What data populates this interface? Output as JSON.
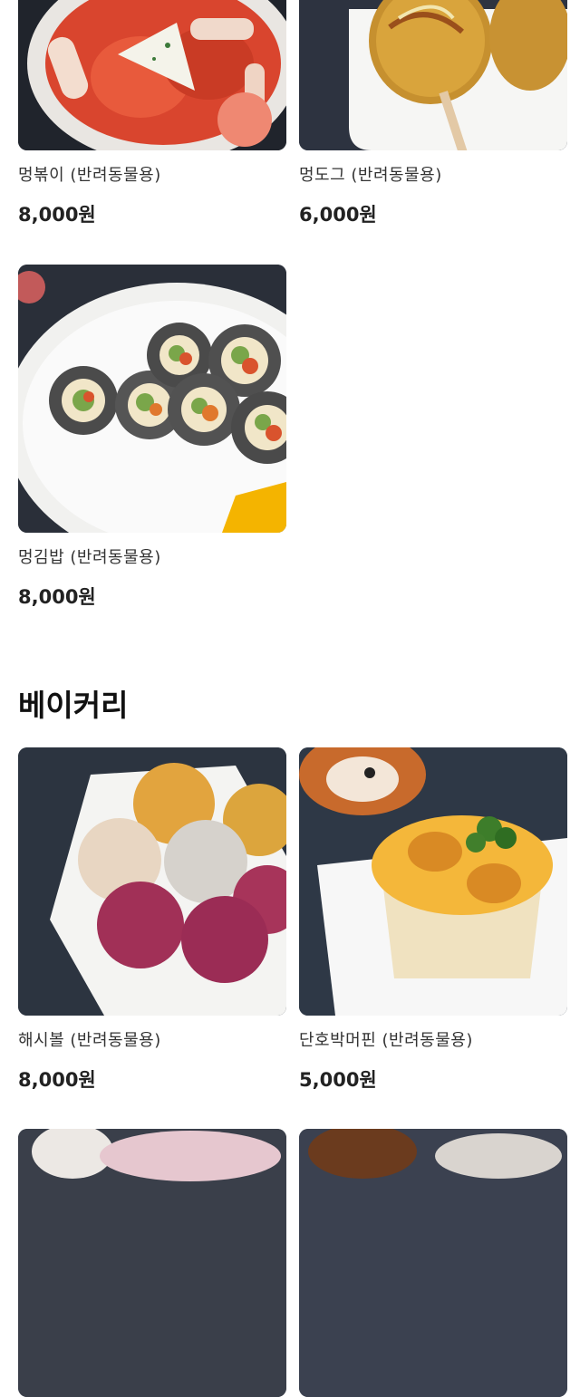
{
  "sections": [
    {
      "title": "",
      "products": [
        {
          "name": "멍볶이 (반려동물용)",
          "price": "8,000원",
          "image": "tteokbokki-photo"
        },
        {
          "name": "멍도그 (반려동물용)",
          "price": "6,000원",
          "image": "corn-dog-photo"
        },
        {
          "name": "멍김밥 (반려동물용)",
          "price": "8,000원",
          "image": "kimbap-photo"
        }
      ]
    },
    {
      "title": "베이커리",
      "products": [
        {
          "name": "해시볼 (반려동물용)",
          "price": "8,000원",
          "image": "hash-ball-photo"
        },
        {
          "name": "단호박머핀 (반려동물용)",
          "price": "5,000원",
          "image": "pumpkin-muffin-photo"
        },
        {
          "name": "",
          "price": "",
          "image": "partial-product-photo"
        },
        {
          "name": "",
          "price": "",
          "image": "partial-product-photo"
        }
      ]
    }
  ]
}
